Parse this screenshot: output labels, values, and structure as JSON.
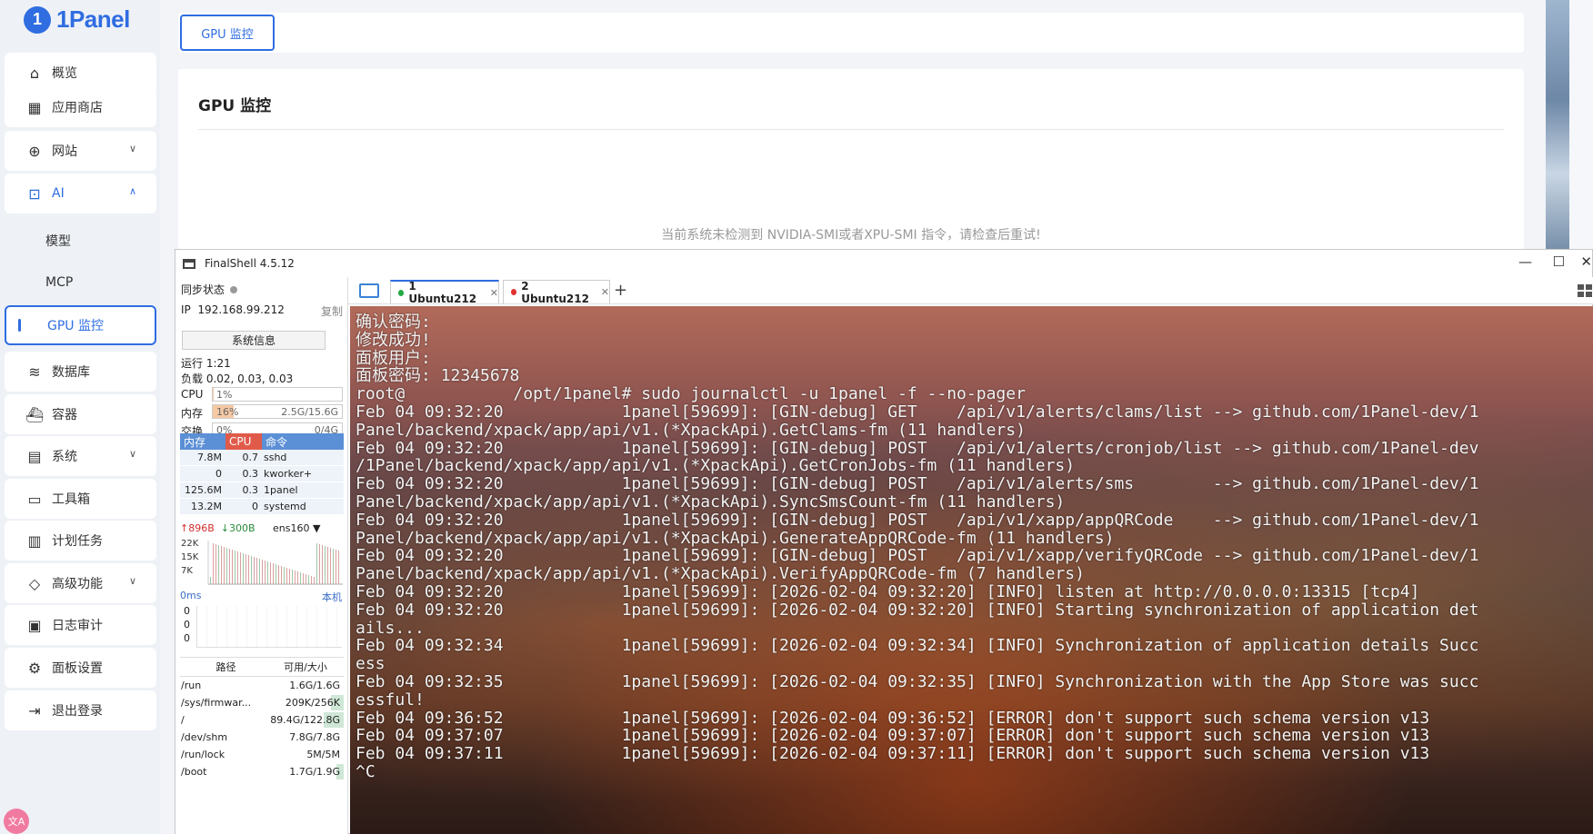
{
  "panel_app": {
    "logo_text": "1Panel",
    "nav": [
      {
        "label": "概览",
        "icon": "home-icon"
      },
      {
        "label": "应用商店",
        "icon": "grid-icon"
      },
      {
        "label": "网站",
        "icon": "globe-icon"
      },
      {
        "label": "AI",
        "icon": "robot-icon"
      },
      {
        "label": "模型"
      },
      {
        "label": "MCP"
      },
      {
        "label": "GPU 监控"
      },
      {
        "label": "数据库",
        "icon": "layers-icon"
      },
      {
        "label": "容器",
        "icon": "container-icon"
      },
      {
        "label": "系统",
        "icon": "server-icon"
      },
      {
        "label": "工具箱",
        "icon": "toolbox-icon"
      },
      {
        "label": "计划任务",
        "icon": "calendar-icon"
      },
      {
        "label": "高级功能",
        "icon": "diamond-icon"
      },
      {
        "label": "日志审计",
        "icon": "log-icon"
      },
      {
        "label": "面板设置",
        "icon": "gear-icon"
      },
      {
        "label": "退出登录",
        "icon": "logout-icon"
      }
    ],
    "tab_label": "GPU 监控",
    "page_title": "GPU 监控",
    "empty_message": "当前系统未检测到 NVIDIA-SMI或者XPU-SMI 指令，请检查后重试!",
    "accent_color": "#2f6de1"
  },
  "finalshell": {
    "title": "FinalShell 4.5.12",
    "sync_label": "同步状态",
    "ip_label": "IP",
    "ip": "192.168.99.212",
    "copy_label": "复制",
    "sysinfo_button": "系统信息",
    "uptime": "运行 1:21",
    "load": "负载 0.02, 0.03, 0.03",
    "cpu": {
      "label": "CPU",
      "text": "1%",
      "percent": 1
    },
    "mem": {
      "label": "内存",
      "text": "16%",
      "percent": 16,
      "detail": "2.5G/15.6G"
    },
    "swap": {
      "label": "交换",
      "text": "0%",
      "percent": 0,
      "detail": "0/4G"
    },
    "proc_headers": [
      "内存",
      "CPU",
      "命令"
    ],
    "processes": [
      {
        "mem": "7.8M",
        "cpu": "0.7",
        "cmd": "sshd"
      },
      {
        "mem": "0",
        "cpu": "0.3",
        "cmd": "kworker+"
      },
      {
        "mem": "125.6M",
        "cpu": "0.3",
        "cmd": "1panel"
      },
      {
        "mem": "13.2M",
        "cpu": "0",
        "cmd": "systemd"
      }
    ],
    "net": {
      "up": "896B",
      "down": "300B",
      "iface": "ens160",
      "ticks": [
        "22K",
        "15K",
        "7K"
      ]
    },
    "latency": {
      "label": "0ms",
      "target": "本机",
      "rows": [
        "0",
        "0",
        "0"
      ]
    },
    "disk_headers": [
      "路径",
      "可用/大小"
    ],
    "disks": [
      {
        "path": "/run",
        "size": "1.6G/1.6G",
        "used": 0
      },
      {
        "path": "/sys/firmwar...",
        "size": "209K/256K",
        "used": 18
      },
      {
        "path": "/",
        "size": "89.4G/122.8G",
        "used": 27
      },
      {
        "path": "/dev/shm",
        "size": "7.8G/7.8G",
        "used": 0
      },
      {
        "path": "/run/lock",
        "size": "5M/5M",
        "used": 0
      },
      {
        "path": "/boot",
        "size": "1.7G/1.9G",
        "used": 10
      }
    ],
    "tabs": [
      {
        "label": "1 Ubuntu212",
        "dot": "#22aa44"
      },
      {
        "label": "2 Ubuntu212",
        "dot": "#e03030"
      }
    ],
    "terminal_lines": [
      "确认密码:",
      "修改成功!",
      "面板用户: ",
      "面板密码: 12345678",
      "root@           /opt/1panel# sudo journalctl -u 1panel -f --no-pager",
      "Feb 04 09:32:20            1panel[59699]: [GIN-debug] GET    /api/v1/alerts/clams/list --> github.com/1Panel-dev/1",
      "Panel/backend/xpack/app/api/v1.(*XpackApi).GetClams-fm (11 handlers)",
      "Feb 04 09:32:20            1panel[59699]: [GIN-debug] POST   /api/v1/alerts/cronjob/list --> github.com/1Panel-dev",
      "/1Panel/backend/xpack/app/api/v1.(*XpackApi).GetCronJobs-fm (11 handlers)",
      "Feb 04 09:32:20            1panel[59699]: [GIN-debug] POST   /api/v1/alerts/sms        --> github.com/1Panel-dev/1",
      "Panel/backend/xpack/app/api/v1.(*XpackApi).SyncSmsCount-fm (11 handlers)",
      "Feb 04 09:32:20            1panel[59699]: [GIN-debug] POST   /api/v1/xapp/appQRCode    --> github.com/1Panel-dev/1",
      "Panel/backend/xpack/app/api/v1.(*XpackApi).GenerateAppQRCode-fm (11 handlers)",
      "Feb 04 09:32:20            1panel[59699]: [GIN-debug] POST   /api/v1/xapp/verifyQRCode --> github.com/1Panel-dev/1",
      "Panel/backend/xpack/app/api/v1.(*XpackApi).VerifyAppQRCode-fm (7 handlers)",
      "Feb 04 09:32:20            1panel[59699]: [2026-02-04 09:32:20] [INFO] listen at http://0.0.0.0:13315 [tcp4]",
      "Feb 04 09:32:20            1panel[59699]: [2026-02-04 09:32:20] [INFO] Starting synchronization of application det",
      "ails...",
      "Feb 04 09:32:34            1panel[59699]: [2026-02-04 09:32:34] [INFO] Synchronization of application details Succ",
      "ess",
      "Feb 04 09:32:35            1panel[59699]: [2026-02-04 09:32:35] [INFO] Synchronization with the App Store was succ",
      "essful!",
      "Feb 04 09:36:52            1panel[59699]: [2026-02-04 09:36:52] [ERROR] don't support such schema version v13",
      "Feb 04 09:37:07            1panel[59699]: [2026-02-04 09:37:07] [ERROR] don't support such schema version v13",
      "Feb 04 09:37:11            1panel[59699]: [2026-02-04 09:37:11] [ERROR] don't support such schema version v13",
      "^C"
    ]
  }
}
